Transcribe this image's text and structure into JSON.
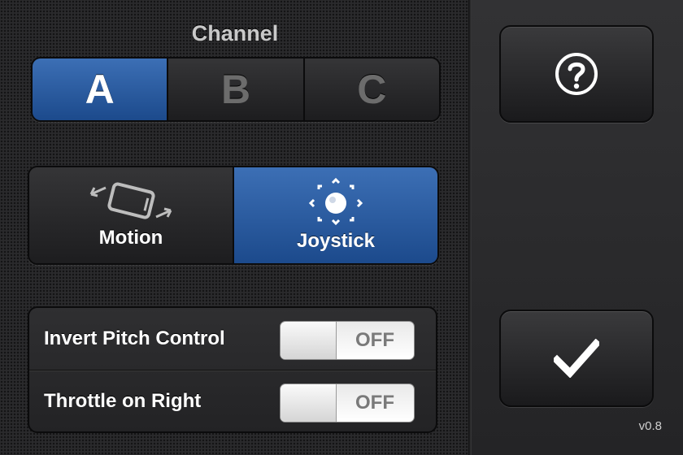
{
  "channel": {
    "title": "Channel",
    "options": [
      "A",
      "B",
      "C"
    ],
    "selected": "A"
  },
  "mode": {
    "options": [
      {
        "label": "Motion",
        "icon": "phone-tilt-icon"
      },
      {
        "label": "Joystick",
        "icon": "joystick-icon"
      }
    ],
    "selected": "Joystick"
  },
  "settings": [
    {
      "label": "Invert Pitch Control",
      "state": "OFF"
    },
    {
      "label": "Throttle on Right",
      "state": "OFF"
    }
  ],
  "buttons": {
    "help_icon": "help-icon",
    "done_icon": "checkmark-icon"
  },
  "version": "v0.8",
  "colors": {
    "accent": "#2a5ea6",
    "panel": "#2a2a2c"
  }
}
